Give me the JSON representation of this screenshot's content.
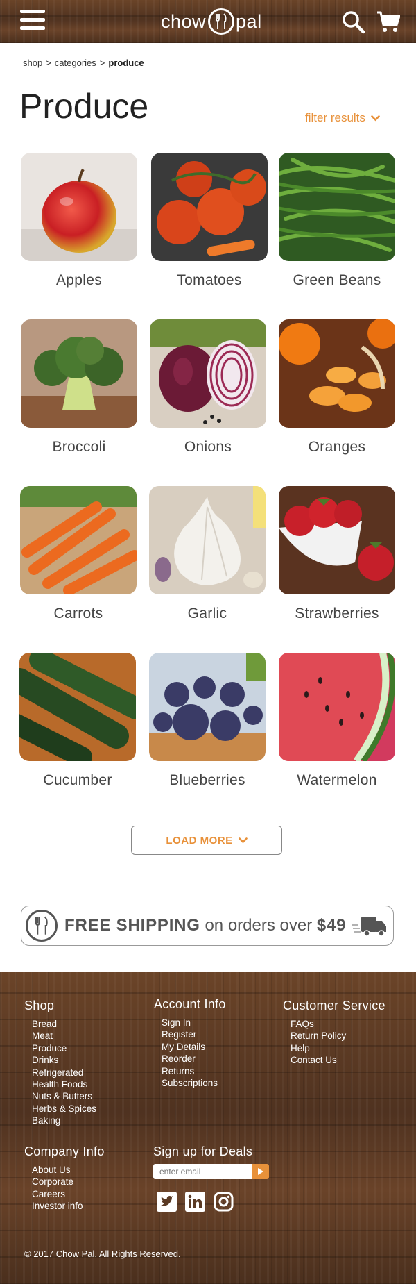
{
  "header": {
    "logo_left": "chow",
    "logo_right": "pal",
    "menu_icon": "hamburger-menu-icon",
    "search_icon": "search-icon",
    "cart_icon": "shopping-cart-icon"
  },
  "breadcrumb": {
    "items": [
      "shop",
      "categories",
      "produce"
    ],
    "separator": ">"
  },
  "page": {
    "title": "Produce",
    "filter_label": "filter results"
  },
  "products": [
    {
      "name": "Apples"
    },
    {
      "name": "Tomatoes"
    },
    {
      "name": "Green Beans"
    },
    {
      "name": "Broccoli"
    },
    {
      "name": "Onions"
    },
    {
      "name": "Oranges"
    },
    {
      "name": "Carrots"
    },
    {
      "name": "Garlic"
    },
    {
      "name": "Strawberries"
    },
    {
      "name": "Cucumber"
    },
    {
      "name": "Blueberries"
    },
    {
      "name": "Watermelon"
    }
  ],
  "load_more": {
    "label": "LOAD MORE"
  },
  "shipping_banner": {
    "bold": "FREE SHIPPING",
    "text": "on orders over",
    "amount": "$49"
  },
  "footer": {
    "shop": {
      "title": "Shop",
      "links": [
        "Bread",
        "Meat",
        "Produce",
        "Drinks",
        "Refrigerated",
        "Health Foods",
        "Nuts & Butters",
        "Herbs & Spices",
        "Baking"
      ]
    },
    "account": {
      "title": "Account Info",
      "links": [
        "Sign In",
        "Register",
        "My Details",
        "Reorder",
        "Returns",
        "Subscriptions"
      ]
    },
    "service": {
      "title": "Customer Service",
      "links": [
        "FAQs",
        "Return Policy",
        "Help",
        "Contact Us"
      ]
    },
    "company": {
      "title": "Company Info",
      "links": [
        "About Us",
        "Corporate",
        "Careers",
        "Investor info"
      ]
    },
    "signup": {
      "title": "Sign up for Deals",
      "placeholder": "enter email"
    },
    "social_icons": [
      "twitter-icon",
      "linkedin-icon",
      "instagram-icon"
    ],
    "copyright": "© 2017 Chow Pal.  All Rights Reserved."
  },
  "colors": {
    "accent": "#e8913a",
    "wood": "#5a3a24",
    "text": "#444444"
  }
}
